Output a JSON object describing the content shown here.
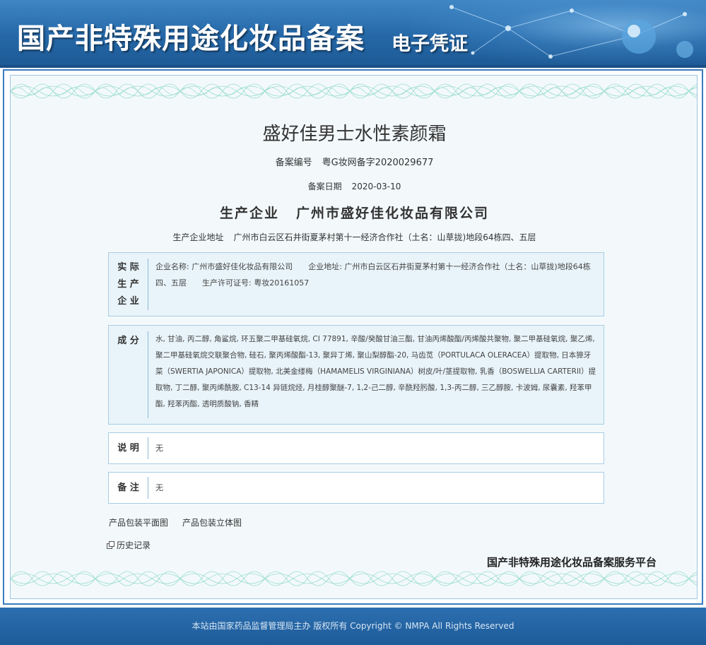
{
  "header": {
    "title": "国产非特殊用途化妆品备案",
    "subtitle": "电子凭证"
  },
  "certificate": {
    "product_name": "盛好佳男士水性素颜霜",
    "registration_label": "备案编号",
    "registration_number": "粤G妆网备字2020029677",
    "date_label": "备案日期",
    "date_value": "2020-03-10",
    "company_label": "生产企业",
    "company_name": "广州市盛好佳化妆品有限公司",
    "address_label": "生产企业地址",
    "address_value": "广州市白云区石井街夏茅村第十一经济合作社（土名：山草拢)地段64栋四、五层"
  },
  "sections": {
    "actual_producer": {
      "label": "实际生产企业",
      "label_lines": [
        "实 际",
        "生 产",
        "企 业"
      ],
      "text": "企业名称: 广州市盛好佳化妆品有限公司　　企业地址: 广州市白云区石井街夏茅村第十一经济合作社（土名：山草拢)地段64栋四、五层　　生产许可证号: 粤妆20161057"
    },
    "ingredients": {
      "label": "成 分",
      "text": "水, 甘油, 丙二醇, 角鲨烷, 环五聚二甲基硅氧烷, CI 77891, 辛酸/癸酸甘油三酯, 甘油丙烯酸酯/丙烯酸共聚物, 聚二甲基硅氧烷, 聚乙烯, 聚二甲基硅氧烷交联聚合物, 硅石, 聚丙烯酸酯-13, 聚异丁烯, 聚山梨醇酯-20, 马齿苋（PORTULACA OLERACEA）提取物, 日本獐牙菜（SWERTIA JAPONICA）提取物, 北美金缕梅（HAMAMELIS VIRGINIANA）树皮/叶/茎提取物, 乳香（BOSWELLIA CARTERII）提取物, 丁二醇, 聚丙烯酰胺, C13-14 异链烷烃, 月桂醇聚醚-7, 1,2-己二醇, 辛酰羟肟酸, 1,3-丙二醇, 三乙醇胺, 卡波姆, 尿囊素, 羟苯甲酯, 羟苯丙酯, 透明质酸钠, 香精"
    },
    "notes": {
      "label": "说 明",
      "text": "无"
    },
    "remarks": {
      "label": "备 注",
      "text": "无"
    }
  },
  "links": {
    "flat_image": "产品包装平面图",
    "three_d_image": "产品包装立体图",
    "history": "历史记录"
  },
  "platform_name": "国产非特殊用途化妆品备案服务平台",
  "footer": {
    "text": "本站由国家药品监督管理局主办 版权所有 Copyright © NMPA All Rights Reserved"
  },
  "colors": {
    "header_blue": "#2568a8",
    "frame_blue": "#3a7bc0",
    "box_bg": "#e9f4fa",
    "wave_green": "#7fd3c2"
  }
}
